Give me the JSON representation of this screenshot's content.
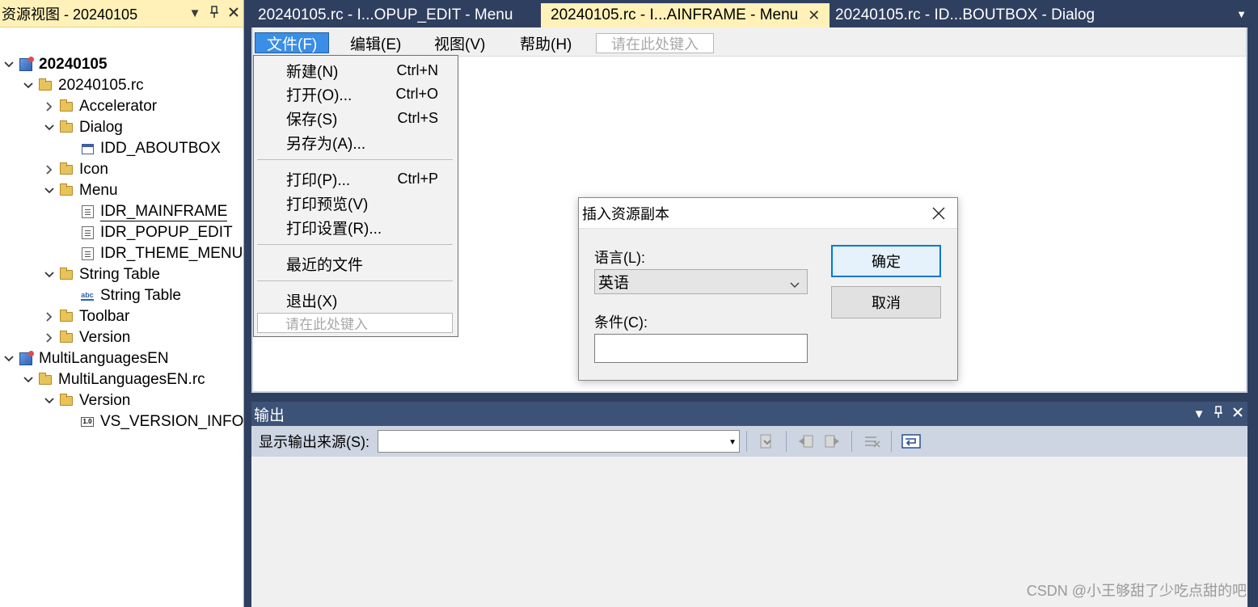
{
  "left_panel": {
    "title": "资源视图 - 20240105",
    "pin_icon": "pin-icon",
    "close_icon": "close-icon",
    "tree": [
      {
        "label": "20240105",
        "bold": true
      },
      {
        "label": "20240105.rc"
      },
      {
        "label": "Accelerator"
      },
      {
        "label": "Dialog"
      },
      {
        "label": "IDD_ABOUTBOX"
      },
      {
        "label": "Icon"
      },
      {
        "label": "Menu"
      },
      {
        "label": "IDR_MAINFRAME"
      },
      {
        "label": "IDR_POPUP_EDIT"
      },
      {
        "label": "IDR_THEME_MENU"
      },
      {
        "label": "String Table"
      },
      {
        "label": "String Table"
      },
      {
        "label": "Toolbar"
      },
      {
        "label": "Version"
      },
      {
        "label": "MultiLanguagesEN",
        "bold": false
      },
      {
        "label": "MultiLanguagesEN.rc"
      },
      {
        "label": "Version"
      },
      {
        "label": "VS_VERSION_INFO"
      }
    ]
  },
  "tabs": [
    {
      "label": "20240105.rc - I...OPUP_EDIT - Menu",
      "active": false
    },
    {
      "label": "20240105.rc - I...AINFRAME - Menu",
      "active": true
    },
    {
      "label": "20240105.rc - ID...BOUTBOX - Dialog",
      "active": false
    }
  ],
  "menubar": {
    "items": [
      "文件(F)",
      "编辑(E)",
      "视图(V)",
      "帮助(H)"
    ],
    "placeholder": "请在此处键入"
  },
  "file_menu": {
    "items": [
      {
        "label": "新建(N)",
        "shortcut": "Ctrl+N"
      },
      {
        "label": "打开(O)...",
        "shortcut": "Ctrl+O"
      },
      {
        "label": "保存(S)",
        "shortcut": "Ctrl+S"
      },
      {
        "label": "另存为(A)...",
        "shortcut": ""
      },
      {
        "label": "打印(P)...",
        "shortcut": "Ctrl+P"
      },
      {
        "label": "打印预览(V)",
        "shortcut": ""
      },
      {
        "label": "打印设置(R)...",
        "shortcut": ""
      },
      {
        "label": "最近的文件",
        "shortcut": ""
      },
      {
        "label": "退出(X)",
        "shortcut": ""
      }
    ],
    "placeholder": "请在此处键入"
  },
  "dialog": {
    "title": "插入资源副本",
    "language_label": "语言(L):",
    "language_value": "英语",
    "condition_label": "条件(C):",
    "condition_value": "",
    "ok_label": "确定",
    "cancel_label": "取消"
  },
  "output": {
    "title": "输出",
    "source_label": "显示输出来源(S):",
    "source_value": ""
  },
  "watermark": "CSDN @小王够甜了少吃点甜的吧",
  "colors": {
    "chrome": "#2f3f5f",
    "active_tab": "#fff1b8",
    "accent": "#0078d7"
  }
}
